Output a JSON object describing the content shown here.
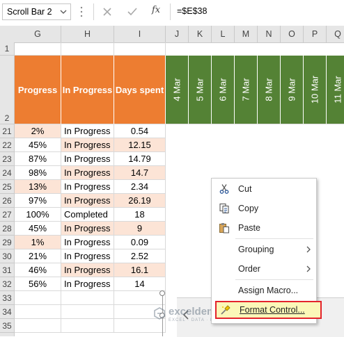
{
  "formula_bar": {
    "name_box": "Scroll Bar 2",
    "fx": "fx",
    "formula": "=$E$38"
  },
  "columns": [
    "G",
    "H",
    "I",
    "J",
    "K",
    "L",
    "M",
    "N",
    "O",
    "P",
    "Q"
  ],
  "rows": [
    "1",
    "2",
    "21",
    "22",
    "23",
    "24",
    "25",
    "26",
    "27",
    "28",
    "29",
    "30",
    "31",
    "32",
    "33",
    "34",
    "35"
  ],
  "header": {
    "progress": "Progress",
    "in_progress": "In Progress",
    "days_spent": "Days spent",
    "dates": [
      "4 Mar",
      "5 Mar",
      "6 Mar",
      "7 Mar",
      "8 Mar",
      "9 Mar",
      "10 Mar",
      "11 Mar"
    ]
  },
  "table": [
    {
      "progress": "2%",
      "status": "In Progress",
      "days": "0.54"
    },
    {
      "progress": "45%",
      "status": "In Progress",
      "days": "12.15"
    },
    {
      "progress": "87%",
      "status": "In Progress",
      "days": "14.79"
    },
    {
      "progress": "98%",
      "status": "In Progress",
      "days": "14.7"
    },
    {
      "progress": "13%",
      "status": "In Progress",
      "days": "2.34"
    },
    {
      "progress": "97%",
      "status": "In Progress",
      "days": "26.19"
    },
    {
      "progress": "100%",
      "status": "Completed",
      "days": "18"
    },
    {
      "progress": "45%",
      "status": "In Progress",
      "days": "9"
    },
    {
      "progress": "1%",
      "status": "In Progress",
      "days": "0.09"
    },
    {
      "progress": "21%",
      "status": "In Progress",
      "days": "2.52"
    },
    {
      "progress": "46%",
      "status": "In Progress",
      "days": "16.1"
    },
    {
      "progress": "56%",
      "status": "In Progress",
      "days": "14"
    }
  ],
  "context_menu": {
    "cut": "Cut",
    "copy": "Copy",
    "paste": "Paste",
    "grouping": "Grouping",
    "order": "Order",
    "assign_macro": "Assign Macro...",
    "format_control": "Format Control..."
  },
  "watermark": {
    "name": "exceldemy",
    "tagline": "EXCEL · DATA · BI"
  },
  "colors": {
    "orange_header": "#ed7d31",
    "green_header": "#548235",
    "peach_fill": "#fce4d6",
    "highlight_border": "#e3232c",
    "highlight_fill": "#fbf7b8"
  }
}
